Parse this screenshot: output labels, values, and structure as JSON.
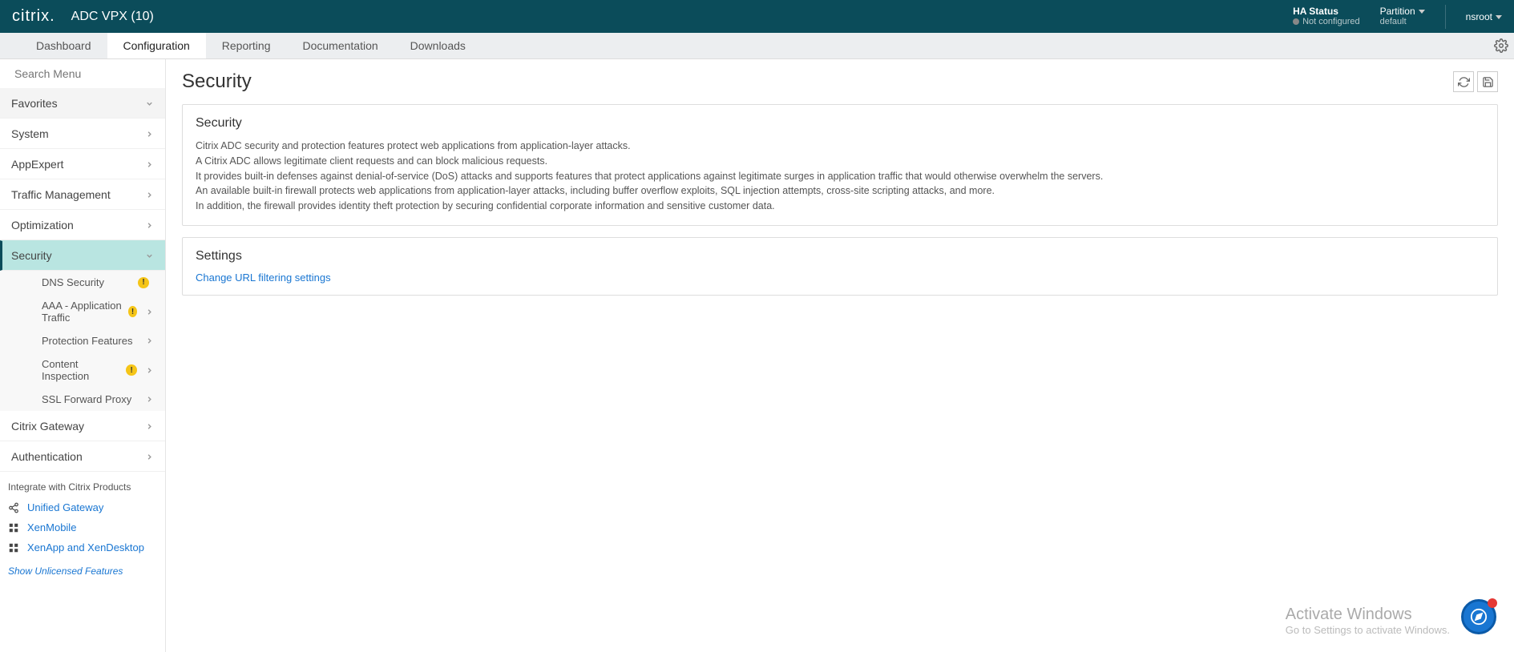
{
  "header": {
    "logo": "citrix.",
    "product": "ADC VPX (10)",
    "ha_label": "HA Status",
    "ha_value": "Not configured",
    "partition_label": "Partition",
    "partition_value": "default",
    "user": "nsroot"
  },
  "tabs": [
    {
      "label": "Dashboard"
    },
    {
      "label": "Configuration"
    },
    {
      "label": "Reporting"
    },
    {
      "label": "Documentation"
    },
    {
      "label": "Downloads"
    }
  ],
  "sidebar": {
    "search_placeholder": "Search Menu",
    "favorites": "Favorites",
    "items": [
      {
        "label": "System"
      },
      {
        "label": "AppExpert"
      },
      {
        "label": "Traffic Management"
      },
      {
        "label": "Optimization"
      },
      {
        "label": "Security"
      }
    ],
    "sub_items": [
      {
        "label": "DNS Security"
      },
      {
        "label": "AAA - Application Traffic"
      },
      {
        "label": "Protection Features"
      },
      {
        "label": "Content Inspection"
      },
      {
        "label": "SSL Forward Proxy"
      }
    ],
    "post_items": [
      {
        "label": "Citrix Gateway"
      },
      {
        "label": "Authentication"
      }
    ],
    "integrate_header": "Integrate with Citrix Products",
    "integrate": [
      {
        "label": "Unified Gateway"
      },
      {
        "label": "XenMobile"
      },
      {
        "label": "XenApp and XenDesktop"
      }
    ],
    "unlicensed": "Show Unlicensed Features"
  },
  "main": {
    "title": "Security",
    "card1_title": "Security",
    "p1": "Citrix ADC security and protection features protect web applications from application-layer attacks.",
    "p2": "A Citrix ADC allows legitimate client requests and can block malicious requests.",
    "p3": "It provides built-in defenses against denial-of-service (DoS) attacks and supports features that protect applications against legitimate surges in application traffic that would otherwise overwhelm the servers.",
    "p4": "An available built-in firewall protects web applications from application-layer attacks, including buffer overflow exploits, SQL injection attempts, cross-site scripting attacks, and more.",
    "p5": "In addition, the firewall provides identity theft protection by securing confidential corporate information and sensitive customer data.",
    "card2_title": "Settings",
    "link1": "Change URL filtering settings"
  },
  "overlay": {
    "activate_title": "Activate Windows",
    "activate_sub": "Go to Settings to activate Windows."
  }
}
